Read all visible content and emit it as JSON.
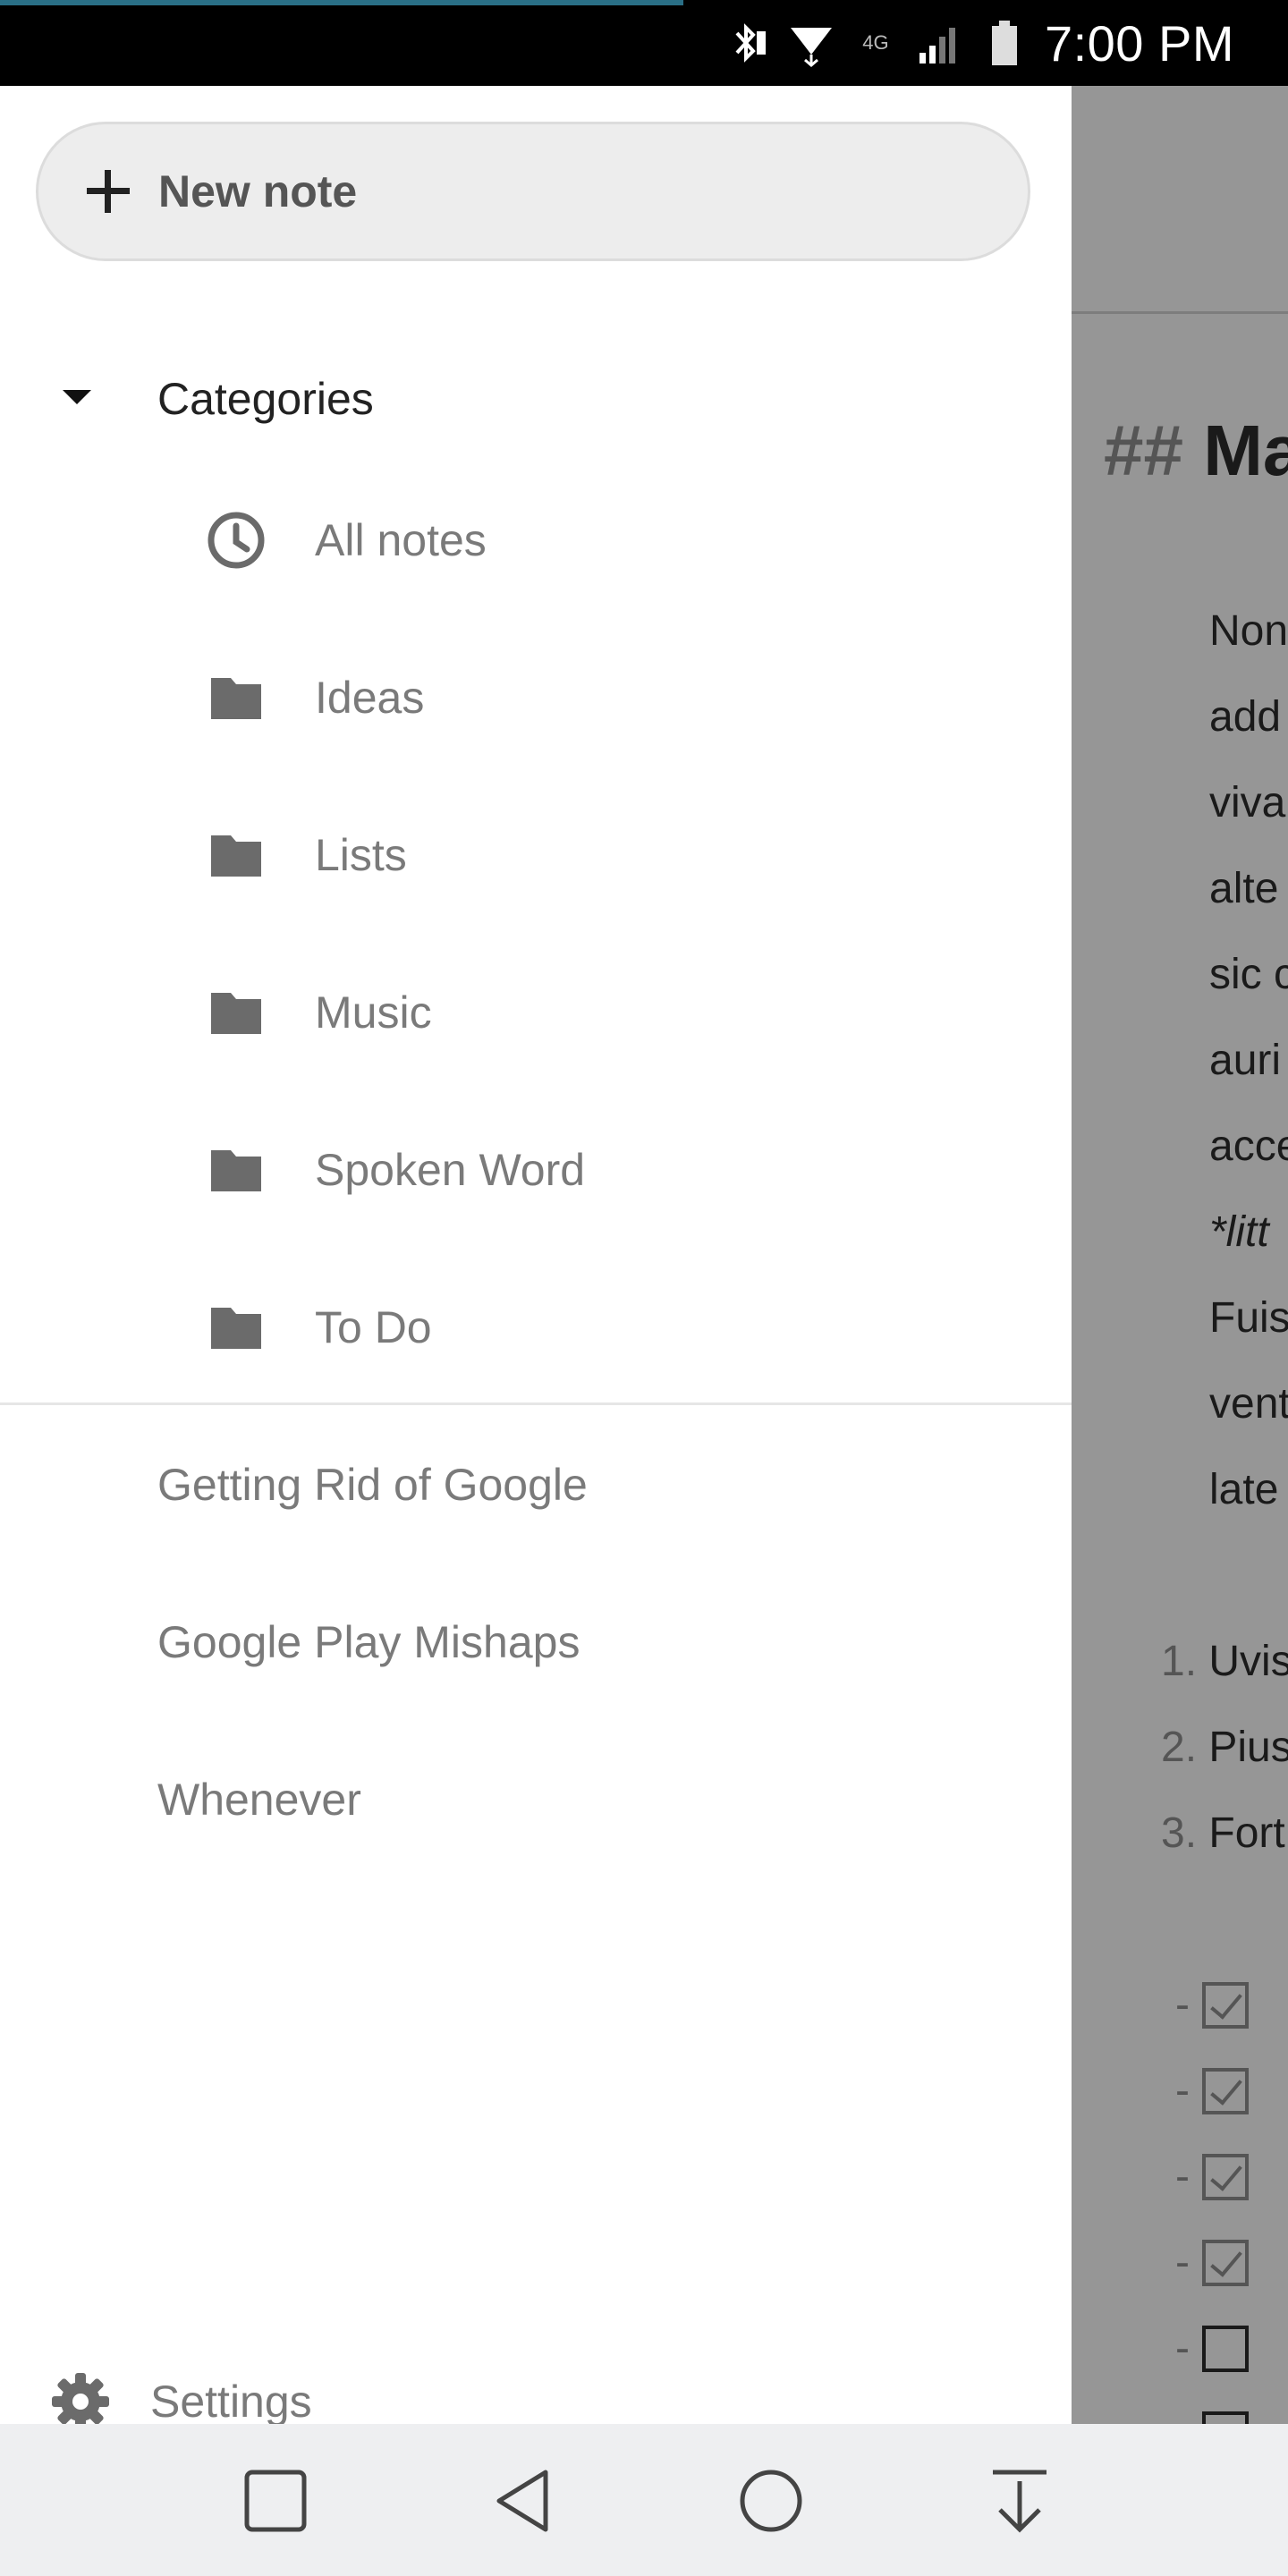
{
  "status_bar": {
    "time": "7:00 PM",
    "network_label": "4G",
    "icons": [
      "bluetooth-icon",
      "wifi-icon",
      "signal-icon",
      "battery-icon"
    ]
  },
  "drawer": {
    "new_note_label": "New note",
    "categories_label": "Categories",
    "categories": [
      {
        "label": "All notes",
        "icon": "clock-icon"
      },
      {
        "label": "Ideas",
        "icon": "folder-icon"
      },
      {
        "label": "Lists",
        "icon": "folder-icon"
      },
      {
        "label": "Music",
        "icon": "folder-icon"
      },
      {
        "label": "Spoken Word",
        "icon": "folder-icon"
      },
      {
        "label": "To Do",
        "icon": "folder-icon"
      }
    ],
    "notes": [
      {
        "label": "Getting Rid of Google"
      },
      {
        "label": "Google Play Mishaps"
      },
      {
        "label": "Whenever"
      }
    ],
    "settings_label": "Settings"
  },
  "content": {
    "heading_hash": "##",
    "heading_text": "Ma",
    "paragraph_lines": [
      "Non",
      "add",
      "viva",
      "alte",
      "sic c",
      "auri",
      "acce",
      "*litt",
      "Fuis",
      "vent",
      "late"
    ],
    "ordered_list": [
      {
        "num": "1.",
        "text": "Uvis"
      },
      {
        "num": "2.",
        "text": "Pius"
      },
      {
        "num": "3.",
        "text": "Fort"
      }
    ],
    "checklist_dash": "-",
    "checklist": [
      true,
      true,
      true,
      true,
      false,
      false
    ]
  },
  "nav_bar": {
    "buttons": [
      "recents-button",
      "back-button",
      "home-button",
      "notification-pull-button"
    ]
  },
  "colors": {
    "status_bar_bg": "#000000",
    "accent_progress": "#2a6f86",
    "drawer_bg": "#ffffff",
    "scrim": "#969696",
    "nav_bar_bg": "#eeeff1"
  }
}
